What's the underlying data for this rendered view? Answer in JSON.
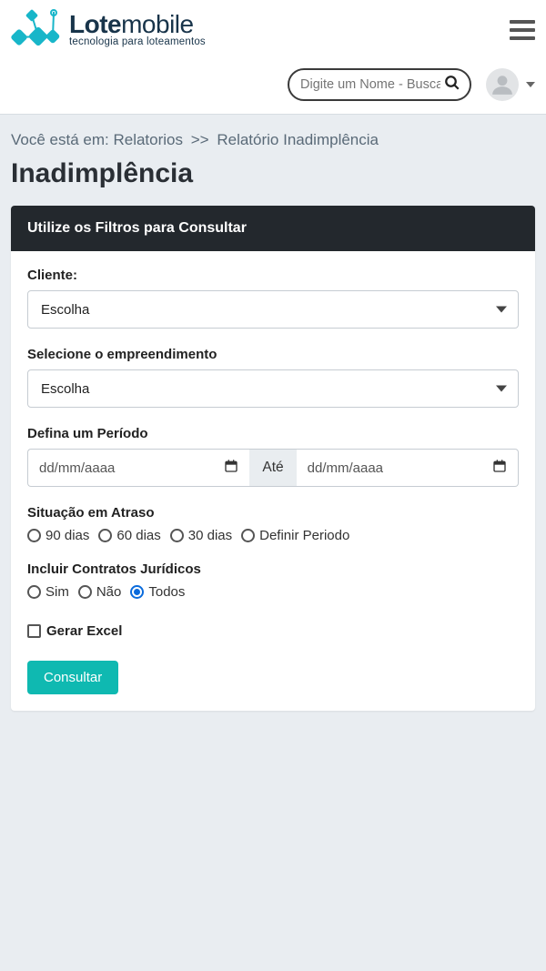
{
  "brand": {
    "name_prefix": "Lote",
    "name_suffix": "mobile",
    "tagline": "tecnologia para loteamentos"
  },
  "search": {
    "placeholder": "Digite um Nome - Buscar"
  },
  "breadcrumb": {
    "label": "Você está em:",
    "items": [
      "Relatorios",
      "Relatório Inadimplência"
    ],
    "separator": ">>"
  },
  "page": {
    "title": "Inadimplência"
  },
  "card": {
    "header": "Utilize os Filtros para Consultar"
  },
  "form": {
    "cliente_label": "Cliente:",
    "cliente_selected": "Escolha",
    "empreendimento_label": "Selecione o empreendimento",
    "empreendimento_selected": "Escolha",
    "periodo_label": "Defina um Período",
    "periodo_placeholder_start": "dd/mm/aaaa",
    "periodo_sep": "Até",
    "periodo_placeholder_end": "dd/mm/aaaa",
    "atraso_label": "Situação em Atraso",
    "atraso_options": [
      "90 dias",
      "60 dias",
      "30 dias",
      "Definir Periodo"
    ],
    "juridico_label": "Incluir Contratos Jurídicos",
    "juridico_options": [
      "Sim",
      "Não",
      "Todos"
    ],
    "juridico_selected_index": 2,
    "excel_label": "Gerar Excel",
    "submit_label": "Consultar"
  }
}
